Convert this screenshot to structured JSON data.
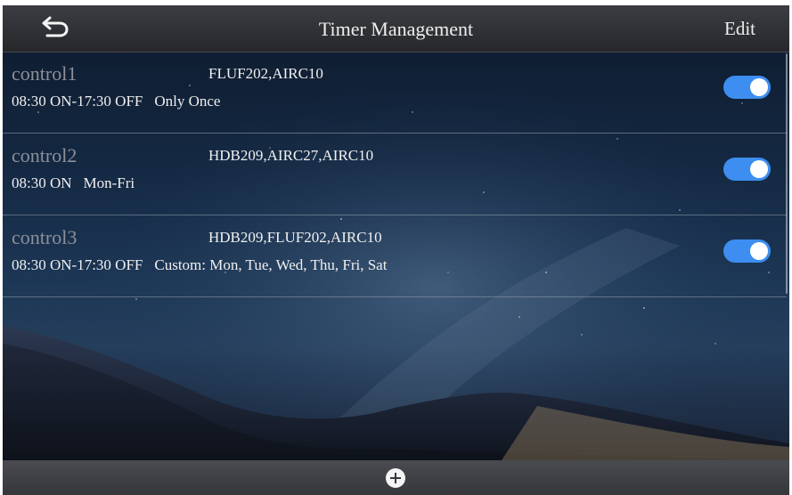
{
  "header": {
    "title": "Timer Management",
    "edit_label": "Edit",
    "back_icon": "back-arrow-icon"
  },
  "timers": [
    {
      "name": "control1",
      "devices": "FLUF202,AIRC10",
      "time": "08:30 ON-17:30 OFF",
      "repeat": "Only Once",
      "enabled": true
    },
    {
      "name": "control2",
      "devices": "HDB209,AIRC27,AIRC10",
      "time": "08:30 ON",
      "repeat": "Mon-Fri",
      "enabled": true
    },
    {
      "name": "control3",
      "devices": "HDB209,FLUF202,AIRC10",
      "time": "08:30 ON-17:30 OFF",
      "repeat": "Custom: Mon, Tue, Wed, Thu, Fri, Sat",
      "enabled": true
    }
  ],
  "footer": {
    "add_icon": "plus-circle-icon"
  },
  "colors": {
    "toggle_on": "#3d8ef0",
    "header_bg": "#2f3034",
    "footer_bg": "#3f4045"
  }
}
